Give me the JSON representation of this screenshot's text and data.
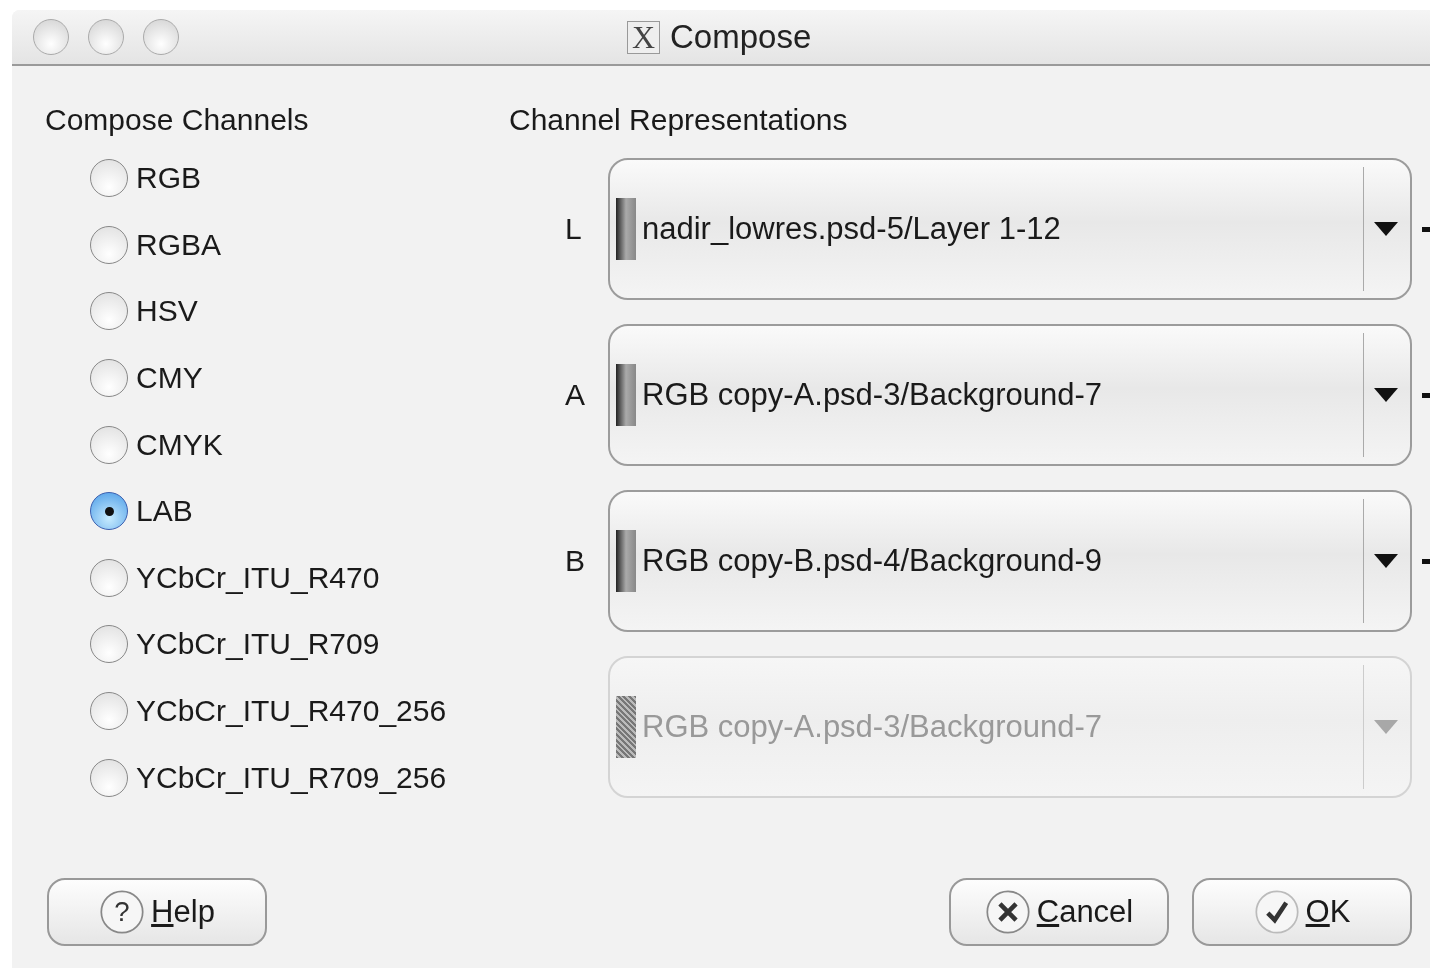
{
  "window": {
    "title": "Compose",
    "title_icon": "X"
  },
  "compose_channels": {
    "heading": "Compose Channels",
    "options": [
      {
        "label": "RGB",
        "selected": false
      },
      {
        "label": "RGBA",
        "selected": false
      },
      {
        "label": "HSV",
        "selected": false
      },
      {
        "label": "CMY",
        "selected": false
      },
      {
        "label": "CMYK",
        "selected": false
      },
      {
        "label": "LAB",
        "selected": true
      },
      {
        "label": "YCbCr_ITU_R470",
        "selected": false
      },
      {
        "label": "YCbCr_ITU_R709",
        "selected": false
      },
      {
        "label": "YCbCr_ITU_R470_256",
        "selected": false
      },
      {
        "label": "YCbCr_ITU_R709_256",
        "selected": false
      }
    ]
  },
  "channel_representations": {
    "heading": "Channel Representations",
    "rows": [
      {
        "label": "L",
        "value": "nadir_lowres.psd-5/Layer 1-12",
        "disabled": false
      },
      {
        "label": "A",
        "value": "RGB copy-A.psd-3/Background-7",
        "disabled": false
      },
      {
        "label": "B",
        "value": "RGB copy-B.psd-4/Background-9",
        "disabled": false
      },
      {
        "value": "RGB copy-A.psd-3/Background-7",
        "disabled": true
      }
    ]
  },
  "buttons": [
    {
      "kind": "help",
      "icon": "?",
      "label": "Help"
    },
    {
      "kind": "cancel",
      "label": "Cancel"
    },
    {
      "kind": "ok",
      "label": "OK"
    }
  ]
}
